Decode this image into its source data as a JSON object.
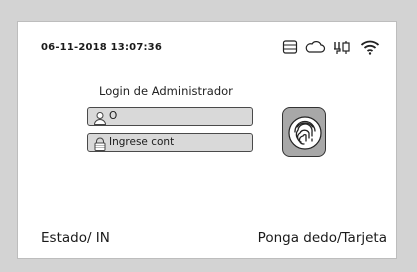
{
  "status_bar": {
    "datetime": "06-11-2018  13:07:36",
    "icons": [
      "storage-icon",
      "cloud-icon",
      "usb-plug-icon",
      "wifi-icon"
    ]
  },
  "login": {
    "title": "Login de Administrador",
    "user_field": {
      "icon": "user-icon",
      "value": "O"
    },
    "password_field": {
      "icon": "lock-icon",
      "placeholder": "Ingrese cont"
    },
    "fingerprint_button": {
      "icon": "fingerprint-icon"
    }
  },
  "footer": {
    "status": "Estado/  IN",
    "prompt": "Ponga dedo/Tarjeta"
  },
  "colors": {
    "frame": "#d3d3d3",
    "screen": "#ffffff",
    "field_bg": "#d9d9d9",
    "button_bg": "#a8a8a8"
  }
}
